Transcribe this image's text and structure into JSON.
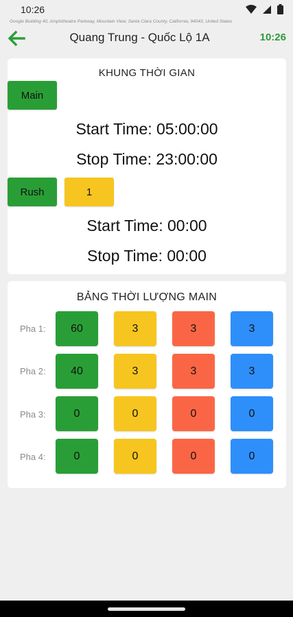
{
  "status_bar": {
    "time": "10:26",
    "icons": [
      "wifi-icon",
      "signal-icon",
      "battery-icon"
    ]
  },
  "address": "Google Building 40, Amphitheatre Parkway, Mountain View, Santa Clara County, California, 94043, United States",
  "header": {
    "back_icon": "arrow-left-icon",
    "title": "Quang Trung - Quốc Lộ 1A",
    "clock": "10:26"
  },
  "time_frame": {
    "title": "KHUNG THỜI GIAN",
    "main_button": "Main",
    "main_start": "Start Time: 05:00:00",
    "main_stop": "Stop Time: 23:00:00",
    "rush_button": "Rush",
    "rush_value": "1",
    "rush_start": "Start Time: 00:00",
    "rush_stop": "Stop Time: 00:00"
  },
  "duration_table": {
    "title": "BẢNG THỜI LƯỢNG MAIN",
    "rows": [
      {
        "label": "Pha 1:",
        "green": "60",
        "yellow": "3",
        "red": "3",
        "blue": "3"
      },
      {
        "label": "Pha 2:",
        "green": "40",
        "yellow": "3",
        "red": "3",
        "blue": "3"
      },
      {
        "label": "Pha 3:",
        "green": "0",
        "yellow": "0",
        "red": "0",
        "blue": "0"
      },
      {
        "label": "Pha 4:",
        "green": "0",
        "yellow": "0",
        "red": "0",
        "blue": "0"
      }
    ]
  },
  "colors": {
    "green": "#2a9e36",
    "yellow": "#f7c51f",
    "red": "#fa6645",
    "blue": "#2e8ffb",
    "clock_green": "#2e9b39"
  }
}
